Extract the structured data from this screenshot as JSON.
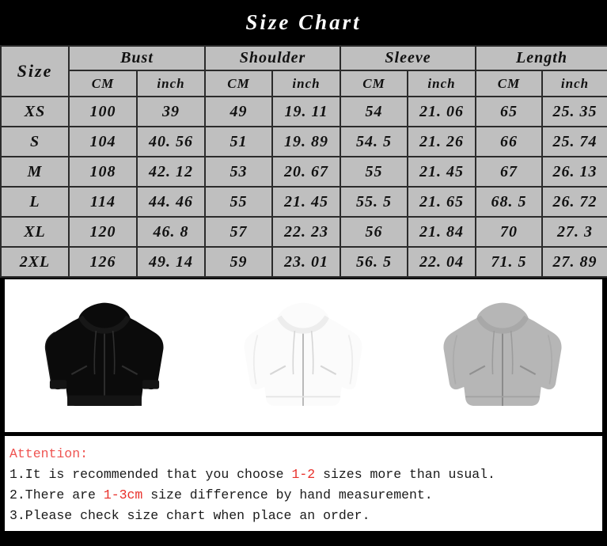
{
  "title": "Size Chart",
  "table": {
    "size_header": "Size",
    "groups": [
      "Bust",
      "Shoulder",
      "Sleeve",
      "Length"
    ],
    "units": [
      "CM",
      "inch"
    ],
    "rows": [
      {
        "size": "XS",
        "bust_cm": "100",
        "bust_in": "39",
        "shoulder_cm": "49",
        "shoulder_in": "19. 11",
        "sleeve_cm": "54",
        "sleeve_in": "21. 06",
        "length_cm": "65",
        "length_in": "25. 35"
      },
      {
        "size": "S",
        "bust_cm": "104",
        "bust_in": "40. 56",
        "shoulder_cm": "51",
        "shoulder_in": "19. 89",
        "sleeve_cm": "54. 5",
        "sleeve_in": "21. 26",
        "length_cm": "66",
        "length_in": "25. 74"
      },
      {
        "size": "M",
        "bust_cm": "108",
        "bust_in": "42. 12",
        "shoulder_cm": "53",
        "shoulder_in": "20. 67",
        "sleeve_cm": "55",
        "sleeve_in": "21. 45",
        "length_cm": "67",
        "length_in": "26. 13"
      },
      {
        "size": "L",
        "bust_cm": "114",
        "bust_in": "44. 46",
        "shoulder_cm": "55",
        "shoulder_in": "21. 45",
        "sleeve_cm": "55. 5",
        "sleeve_in": "21. 65",
        "length_cm": "68. 5",
        "length_in": "26. 72"
      },
      {
        "size": "XL",
        "bust_cm": "120",
        "bust_in": "46. 8",
        "shoulder_cm": "57",
        "shoulder_in": "22. 23",
        "sleeve_cm": "56",
        "sleeve_in": "21. 84",
        "length_cm": "70",
        "length_in": "27. 3"
      },
      {
        "size": "2XL",
        "bust_cm": "126",
        "bust_in": "49. 14",
        "shoulder_cm": "59",
        "shoulder_in": "23. 01",
        "sleeve_cm": "56. 5",
        "sleeve_in": "22. 04",
        "length_cm": "71. 5",
        "length_in": "27. 89"
      }
    ]
  },
  "products": [
    {
      "name": "black-zip-hoodie",
      "color_label": "black",
      "body": "#0b0b0b",
      "shade": "#171717",
      "line": "#2e2e2e"
    },
    {
      "name": "white-zip-hoodie",
      "color_label": "white",
      "body": "#fbfbfb",
      "shade": "#ededed",
      "line": "#d6d6d6"
    },
    {
      "name": "grey-zip-hoodie",
      "color_label": "grey",
      "body": "#b6b6b6",
      "shade": "#a8a8a8",
      "line": "#909090"
    }
  ],
  "attention": {
    "heading": "Attention:",
    "items": [
      {
        "prefix": "1.It is recommended that you choose ",
        "highlight": "1-2",
        "suffix": " sizes more than usual."
      },
      {
        "prefix": "2.There are ",
        "highlight": "1-3cm",
        "suffix": " size difference by hand measurement."
      },
      {
        "prefix": "3.Please check size chart when place an order.",
        "highlight": "",
        "suffix": ""
      }
    ]
  },
  "colors": {
    "background": "#000000",
    "table_bg": "#bfbfbf",
    "grid": "#2b2b2b",
    "accent_red": "#ee1b22",
    "title": "#ffffff",
    "panel": "#ffffff"
  }
}
